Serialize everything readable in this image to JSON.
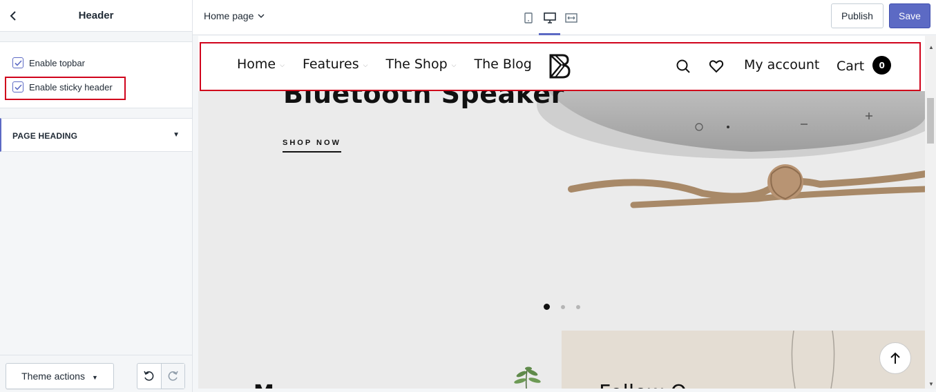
{
  "sidebar": {
    "title": "Header",
    "checkboxes": [
      {
        "label": "Enable topbar",
        "checked": true
      },
      {
        "label": "Enable sticky header",
        "checked": true
      }
    ],
    "accordion_label": "PAGE HEADING",
    "theme_actions_label": "Theme actions"
  },
  "topbar": {
    "page_selector": "Home page",
    "devices": [
      "mobile",
      "desktop",
      "full-width"
    ],
    "active_device": "desktop",
    "publish_label": "Publish",
    "save_label": "Save"
  },
  "preview": {
    "nav": [
      "Home",
      "Features",
      "The Shop",
      "The Blog"
    ],
    "my_account": "My account",
    "cart_label": "Cart",
    "cart_count": "0",
    "hero_title": "Bluetooth Speaker",
    "hero_cta": "SHOP NOW",
    "slider_active_index": 0,
    "slider_dot_count": 3,
    "bottom_left_text": "M",
    "bottom_right_text": "Follow O"
  },
  "colors": {
    "accent": "#5c6ac4",
    "highlight": "#d0021b"
  },
  "icons": [
    "back-icon",
    "chevron-down-icon",
    "mobile-icon",
    "desktop-icon",
    "full-width-icon",
    "search-icon",
    "heart-icon",
    "undo-icon",
    "redo-icon",
    "arrow-up-icon",
    "checkbox-checked-icon"
  ]
}
